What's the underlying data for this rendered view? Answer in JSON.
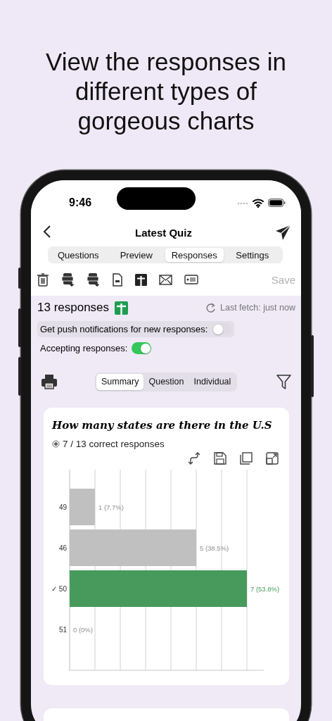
{
  "headline": "View the responses in different types of gorgeous charts",
  "status_bar": {
    "time": "9:46"
  },
  "nav": {
    "title": "Latest Quiz"
  },
  "tabs": [
    {
      "label": "Questions",
      "selected": false
    },
    {
      "label": "Preview",
      "selected": false
    },
    {
      "label": "Responses",
      "selected": true
    },
    {
      "label": "Settings",
      "selected": false
    }
  ],
  "toolbar": {
    "save": {
      "label": "Save",
      "disabled": true
    }
  },
  "summary": {
    "count": "13 responses",
    "last_fetch": "Last fetch: just now"
  },
  "settings": [
    {
      "label": "Get push notifications for new responses:",
      "on": false
    },
    {
      "label": "Accepting responses:",
      "on": true
    }
  ],
  "views": [
    {
      "label": "Summary",
      "selected": true
    },
    {
      "label": "Question",
      "selected": false
    },
    {
      "label": "Individual",
      "selected": false
    }
  ],
  "question": {
    "title": "How many states are there in the U.S",
    "score": "7 / 13 correct responses",
    "chart_data": {
      "type": "bar",
      "orientation": "horizontal",
      "categories": [
        "49",
        "46",
        "✓ 50",
        "51"
      ],
      "values": [
        1,
        5,
        7,
        0
      ],
      "colors": [
        "#c0c0c0",
        "#c0c0c0",
        "#479a5c",
        "#c0c0c0"
      ],
      "value_labels": [
        "1 (7.7%)",
        "5 (38.5%)",
        "7 (53.8%)",
        "0 (0%)"
      ]
    }
  }
}
